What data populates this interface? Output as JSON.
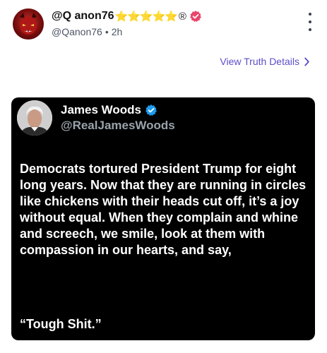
{
  "post": {
    "display_name": "@Q anon76",
    "stars": "⭐⭐⭐⭐⭐",
    "registered_mark": "®",
    "handle": "@Qanon76",
    "separator": "•",
    "time_ago": "2h",
    "details_link": "View Truth Details"
  },
  "embedded_tweet": {
    "name": "James Woods",
    "handle": "@RealJamesWoods",
    "body": "Democrats tortured President Trump for eight long years. Now that they are running in circles like chickens with their heads cut off, it’s a joy without equal. When they complain and whine and screech, we smile, look at them with compassion in our hearts, and say,",
    "quote": "“Tough Shit.”"
  },
  "colors": {
    "link": "#5b4fc7",
    "verified_pink": "#e8456b",
    "verified_blue": "#1d9bf0",
    "card_background": "#000000"
  },
  "icons": {
    "more": "vertical-ellipsis",
    "chevron": "chevron-right",
    "verified": "verified-badge"
  }
}
